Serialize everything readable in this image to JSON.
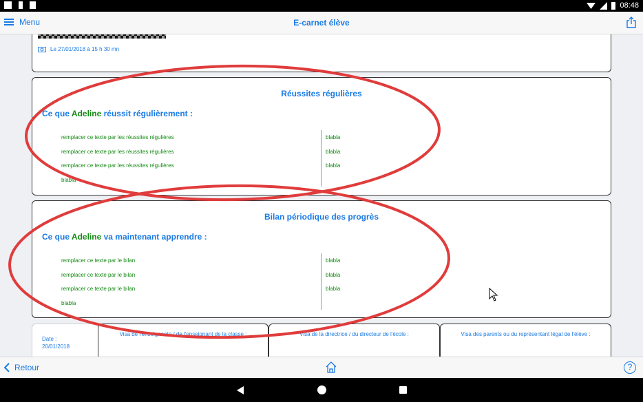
{
  "status_bar": {
    "time": "08:48"
  },
  "nav": {
    "menu_label": "Menu",
    "title": "E-carnet élève"
  },
  "photo": {
    "date_text": "Le 27/01/2018 à 15 h 30 mn"
  },
  "success": {
    "title": "Réussites régulières",
    "subtitle_prefix": "Ce que",
    "student": "Adeline",
    "subtitle_suffix": "réussit régulièrement :",
    "left_items": [
      "remplacer ce texte par les réussites régulières",
      "remplacer ce texte par les réussites régulières",
      "remplacer ce texte par les réussites régulières",
      "blabla"
    ],
    "right_items": [
      "blabla",
      "blabla",
      "blabla"
    ]
  },
  "bilan": {
    "title": "Bilan périodique des progrès",
    "subtitle_prefix": "Ce que",
    "student": "Adeline",
    "subtitle_suffix": "va maintenant apprendre :",
    "left_items": [
      "remplacer ce texte par le bilan",
      "remplacer ce texte par le bilan",
      "remplacer ce texte par le bilan",
      "blabla"
    ],
    "right_items": [
      "blabla",
      "blabla",
      "blabla"
    ]
  },
  "visa": {
    "date_label": "Date :",
    "date_value": "20/01/2018",
    "teacher": "Visa de l'enseignante / de l'enseignant de la classe :",
    "director": "Visa de la directrice / du directeur de l'école :",
    "parents": "Visa des parents ou du représentant légal de l'élève :"
  },
  "bottom": {
    "back_label": "Retour",
    "help_label": "?"
  },
  "colors": {
    "accent": "#1a7ae3",
    "green": "#158a15",
    "annotation": "#e03c3c"
  }
}
